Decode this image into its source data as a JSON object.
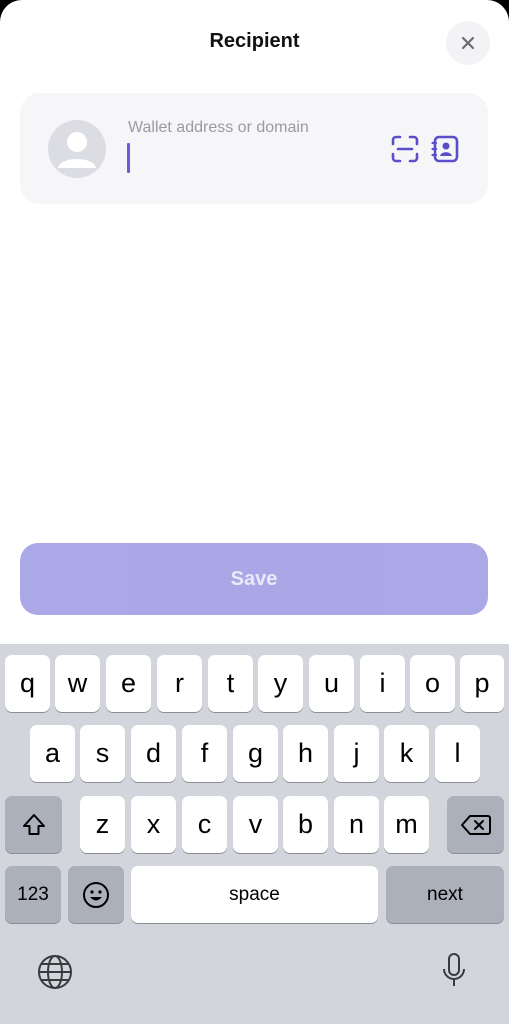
{
  "header": {
    "title": "Recipient",
    "close_icon": "close-icon"
  },
  "recipient_input": {
    "placeholder": "Wallet address or domain",
    "value": "",
    "avatar_icon": "avatar-placeholder-icon",
    "scan_icon": "qr-scan-icon",
    "contacts_icon": "contacts-book-icon"
  },
  "save_button": {
    "label": "Save",
    "enabled": false
  },
  "keyboard": {
    "row1": [
      "q",
      "w",
      "e",
      "r",
      "t",
      "y",
      "u",
      "i",
      "o",
      "p"
    ],
    "row2": [
      "a",
      "s",
      "d",
      "f",
      "g",
      "h",
      "j",
      "k",
      "l"
    ],
    "row3": [
      "z",
      "x",
      "c",
      "v",
      "b",
      "n",
      "m"
    ],
    "numbers_label": "123",
    "space_label": "space",
    "return_label": "next",
    "shift_icon": "shift-icon",
    "delete_icon": "backspace-icon",
    "emoji_icon": "emoji-icon",
    "globe_icon": "globe-icon",
    "mic_icon": "microphone-icon"
  },
  "colors": {
    "accent": "#6a5bd6",
    "save_disabled": "#a6a3e6",
    "card_bg": "#f6f6f9",
    "keyboard_bg": "#d2d5db"
  }
}
